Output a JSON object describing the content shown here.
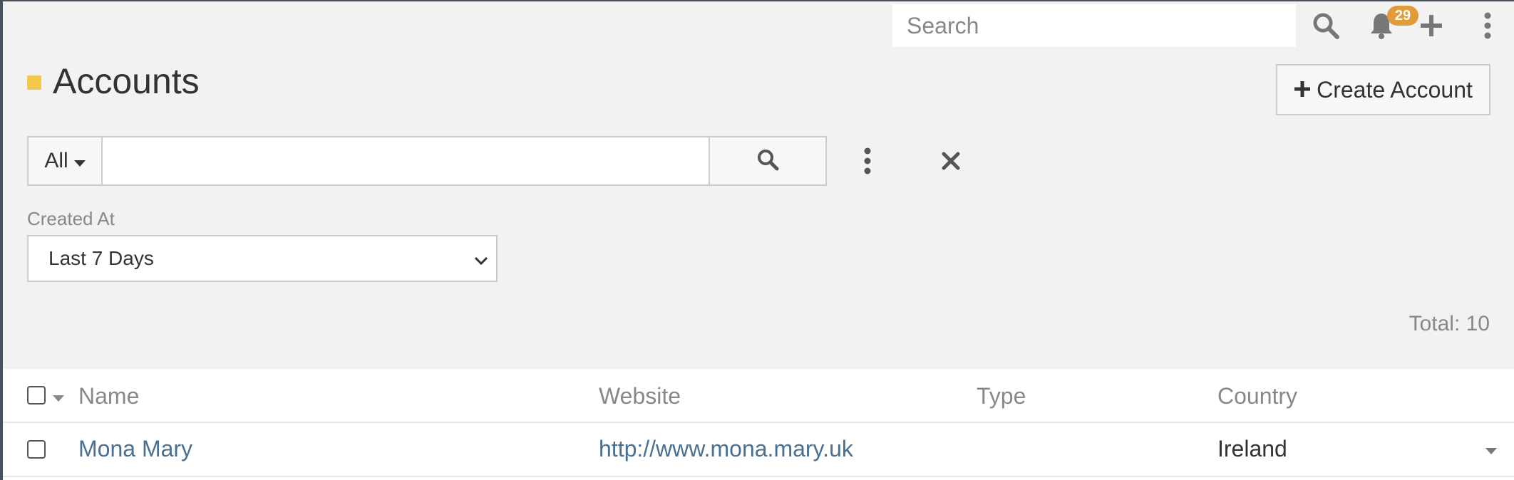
{
  "topbar": {
    "search_placeholder": "Search",
    "notification_count": "29",
    "icons": [
      "search-icon",
      "bell-icon",
      "plus-icon",
      "kebab-menu-icon"
    ]
  },
  "header": {
    "title": "Accounts",
    "accent_color": "#f2c94c",
    "create_button_label": "Create Account"
  },
  "filter": {
    "scope_label": "All",
    "search_value": "",
    "created_at_label": "Created At",
    "created_at_selected": "Last 7 Days"
  },
  "total_text": "Total: 10",
  "table": {
    "columns": [
      "Name",
      "Website",
      "Type",
      "Country"
    ],
    "rows": [
      {
        "name": "Mona Mary",
        "website": "http://www.mona.mary.uk",
        "type": "",
        "country": "Ireland"
      }
    ]
  },
  "colors": {
    "link": "#4a6f8f",
    "badge": "#e09c38",
    "sidebar_edge": "#46525e"
  }
}
